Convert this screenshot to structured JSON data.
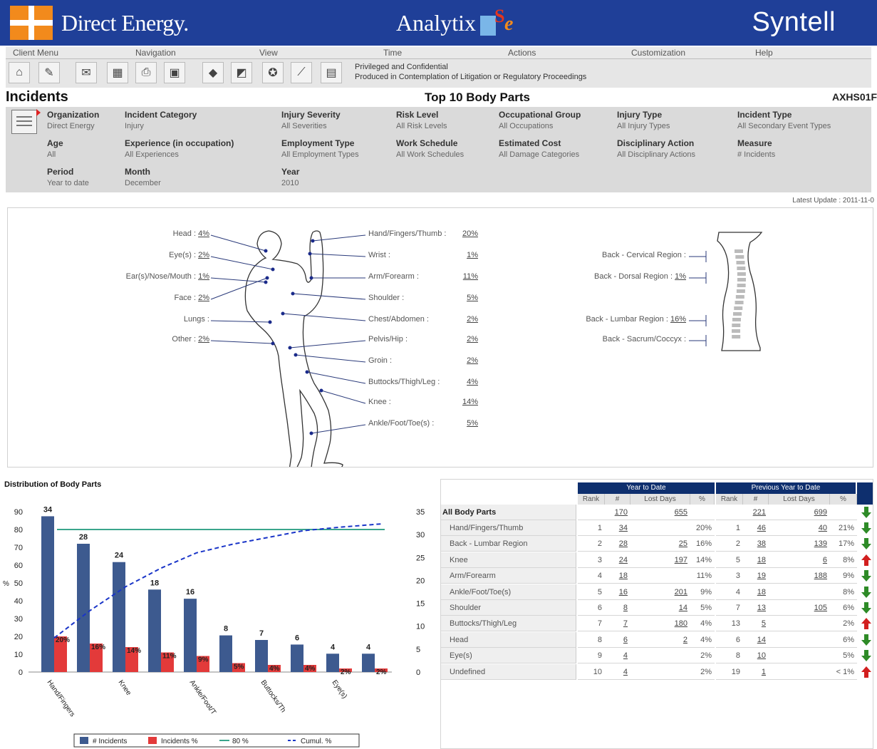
{
  "header": {
    "brand": "Direct Energy.",
    "product": "Analytix",
    "vendor": "Syntell"
  },
  "menu": [
    "Client Menu",
    "Navigation",
    "View",
    "Time",
    "Actions",
    "Customization",
    "Help"
  ],
  "toolbar": {
    "notice_line1": "Privileged and Confidential",
    "notice_line2": "Produced in Contemplation of Litigation or Regulatory Proceedings",
    "icons": [
      "home-icon",
      "edit-icon",
      "email-icon",
      "excel-icon",
      "print-icon",
      "pdf-icon",
      "diamond-icon",
      "chart-window-icon",
      "award-icon",
      "line-chart-icon",
      "report-icon"
    ]
  },
  "titles": {
    "left": "Incidents",
    "center": "Top 10 Body Parts",
    "right": "AXHS01F"
  },
  "filters": [
    {
      "label": "Organization",
      "value": "Direct Energy"
    },
    {
      "label": "Incident Category",
      "value": "Injury"
    },
    {
      "label": "Injury Severity",
      "value": "All Severities"
    },
    {
      "label": "Risk Level",
      "value": "All Risk Levels"
    },
    {
      "label": "Occupational Group",
      "value": "All Occupations"
    },
    {
      "label": "Injury Type",
      "value": "All Injury Types"
    },
    {
      "label": "Incident Type",
      "value": "All Secondary Event Types"
    },
    {
      "label": "Age",
      "value": "All"
    },
    {
      "label": "Experience (in occupation)",
      "value": "All Experiences"
    },
    {
      "label": "Employment Type",
      "value": "All Employment Types"
    },
    {
      "label": "Work Schedule",
      "value": "All Work Schedules"
    },
    {
      "label": "Estimated Cost",
      "value": "All Damage Categories"
    },
    {
      "label": "Disciplinary Action",
      "value": "All Disciplinary Actions"
    },
    {
      "label": "Measure",
      "value": "# Incidents"
    },
    {
      "label": "Period",
      "value": "Year to date"
    },
    {
      "label": "Month",
      "value": "December"
    },
    {
      "label": "Year",
      "value": "2010"
    }
  ],
  "latest_update": "Latest Update : 2011-11-0",
  "body_map": {
    "left_labels": [
      {
        "name": "Head :",
        "pct": "4%"
      },
      {
        "name": "Eye(s) :",
        "pct": "2%"
      },
      {
        "name": "Ear(s)/Nose/Mouth :",
        "pct": "1%"
      },
      {
        "name": "Face :",
        "pct": "2%"
      },
      {
        "name": "Lungs :",
        "pct": ""
      },
      {
        "name": "Other :",
        "pct": "2%"
      }
    ],
    "right_labels": [
      {
        "name": "Hand/Fingers/Thumb :",
        "pct": "20%"
      },
      {
        "name": "Wrist :",
        "pct": "1%"
      },
      {
        "name": "Arm/Forearm :",
        "pct": "11%"
      },
      {
        "name": "Shoulder :",
        "pct": "5%"
      },
      {
        "name": "Chest/Abdomen :",
        "pct": "2%"
      },
      {
        "name": "Pelvis/Hip :",
        "pct": "2%"
      },
      {
        "name": "Groin :",
        "pct": "2%"
      },
      {
        "name": "Buttocks/Thigh/Leg :",
        "pct": "4%"
      },
      {
        "name": "Knee :",
        "pct": "14%"
      },
      {
        "name": "Ankle/Foot/Toe(s) :",
        "pct": "5%"
      }
    ],
    "spine_labels": [
      {
        "name": "Back - Cervical Region :",
        "pct": ""
      },
      {
        "name": "Back - Dorsal Region :",
        "pct": "1%"
      },
      {
        "name": "Back - Lumbar Region :",
        "pct": "16%"
      },
      {
        "name": "Back - Sacrum/Coccyx :",
        "pct": ""
      }
    ]
  },
  "chart_data": {
    "type": "bar",
    "title": "Distribution of Body Parts",
    "categories": [
      "Hand/Fingers",
      "Back - Lumbar",
      "Knee",
      "Arm/Forearm",
      "Ankle/Foot/T",
      "Shoulder",
      "Buttocks/Th",
      "Head",
      "Eye(s)",
      "Undefined"
    ],
    "x_tick_labels": [
      "Hand/Fingers",
      "Knee",
      "Ankle/Foot/T",
      "Buttocks/Th",
      "Eye(s)"
    ],
    "x_tick_indices": [
      0,
      2,
      4,
      6,
      8
    ],
    "series": [
      {
        "name": "# Incidents",
        "color": "#3d5a8f",
        "values": [
          34,
          28,
          24,
          18,
          16,
          8,
          7,
          6,
          4,
          4
        ],
        "labels": [
          "34",
          "28",
          "24",
          "18",
          "16",
          "8",
          "7",
          "6",
          "4",
          "4"
        ]
      },
      {
        "name": "Incidents %",
        "color": "#e33a3a",
        "values": [
          20,
          16,
          14,
          11,
          9,
          5,
          4,
          4,
          2,
          2
        ],
        "labels": [
          "20%",
          "16%",
          "14%",
          "11%",
          "9%",
          "5%",
          "4%",
          "4%",
          "2%",
          "2%"
        ]
      }
    ],
    "lines": [
      {
        "name": "80 %",
        "color": "#3aa58c",
        "value": 80
      },
      {
        "name": "Cumul. %",
        "color": "#1a35c8",
        "values": [
          20,
          36,
          50,
          61,
          70,
          75,
          79,
          83,
          85,
          87
        ]
      }
    ],
    "left_axis": {
      "ticks": [
        "90",
        "80",
        "70",
        "60",
        "50",
        "40",
        "30",
        "20",
        "10",
        "0"
      ],
      "ylim": [
        0,
        90
      ],
      "label": "%"
    },
    "right_axis": {
      "ticks": [
        "35",
        "30",
        "25",
        "20",
        "15",
        "10",
        "5",
        "0"
      ],
      "ylim": [
        0,
        35
      ]
    },
    "legend": [
      "# Incidents",
      "Incidents %",
      "80 %",
      "Cumul. %"
    ]
  },
  "table": {
    "group1": "Year to Date",
    "group2": "Previous Year to Date",
    "subheaders": [
      "Rank",
      "#",
      "Lost Days",
      "%",
      "Rank",
      "#",
      "Lost Days",
      "%"
    ],
    "total": {
      "name": "All Body Parts",
      "count": "170",
      "lost": "655",
      "pcount": "221",
      "plost": "699",
      "trend": "down"
    },
    "rows": [
      {
        "name": "Hand/Fingers/Thumb",
        "rank": "1",
        "count": "34",
        "lost": "",
        "pct": "20%",
        "prank": "1",
        "pcount": "46",
        "plost": "40",
        "ppct": "21%",
        "trend": "down"
      },
      {
        "name": "Back - Lumbar Region",
        "rank": "2",
        "count": "28",
        "lost": "25",
        "pct": "16%",
        "prank": "2",
        "pcount": "38",
        "plost": "139",
        "ppct": "17%",
        "trend": "down"
      },
      {
        "name": "Knee",
        "rank": "3",
        "count": "24",
        "lost": "197",
        "pct": "14%",
        "prank": "5",
        "pcount": "18",
        "plost": "6",
        "ppct": "8%",
        "trend": "up"
      },
      {
        "name": "Arm/Forearm",
        "rank": "4",
        "count": "18",
        "lost": "",
        "pct": "11%",
        "prank": "3",
        "pcount": "19",
        "plost": "188",
        "ppct": "9%",
        "trend": "down"
      },
      {
        "name": "Ankle/Foot/Toe(s)",
        "rank": "5",
        "count": "16",
        "lost": "201",
        "pct": "9%",
        "prank": "4",
        "pcount": "18",
        "plost": "",
        "ppct": "8%",
        "trend": "down"
      },
      {
        "name": "Shoulder",
        "rank": "6",
        "count": "8",
        "lost": "14",
        "pct": "5%",
        "prank": "7",
        "pcount": "13",
        "plost": "105",
        "ppct": "6%",
        "trend": "down"
      },
      {
        "name": "Buttocks/Thigh/Leg",
        "rank": "7",
        "count": "7",
        "lost": "180",
        "pct": "4%",
        "prank": "13",
        "pcount": "5",
        "plost": "",
        "ppct": "2%",
        "trend": "up"
      },
      {
        "name": "Head",
        "rank": "8",
        "count": "6",
        "lost": "2",
        "pct": "4%",
        "prank": "6",
        "pcount": "14",
        "plost": "",
        "ppct": "6%",
        "trend": "down"
      },
      {
        "name": "Eye(s)",
        "rank": "9",
        "count": "4",
        "lost": "",
        "pct": "2%",
        "prank": "8",
        "pcount": "10",
        "plost": "",
        "ppct": "5%",
        "trend": "down"
      },
      {
        "name": "Undefined",
        "rank": "10",
        "count": "4",
        "lost": "",
        "pct": "2%",
        "prank": "19",
        "pcount": "1",
        "plost": "",
        "ppct": "< 1%",
        "trend": "up"
      }
    ]
  }
}
